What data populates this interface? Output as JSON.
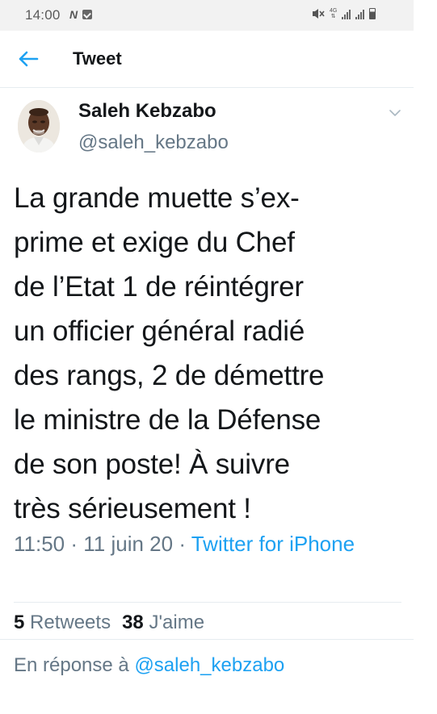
{
  "status_bar": {
    "time": "14:00",
    "network": "4G",
    "icons": [
      "notification-n-icon",
      "checkbox-notification-icon",
      "mute-icon",
      "signal-icon",
      "signal-icon",
      "battery-icon"
    ]
  },
  "header": {
    "title": "Tweet",
    "back_icon": "back-arrow-icon",
    "accent": "#1da1f2"
  },
  "tweet": {
    "author_name": "Saleh Kebzabo",
    "author_handle": "@saleh_kebzabo",
    "text": "La grande muette s’ex-\nprime et exige du Chef\nde l’Etat 1 de réintégrer\nun officier général radié\ndes rangs, 2 de démettre\nle ministre de la Défense\nde son poste! À suivre\ntrès sérieusement !",
    "time": "11:50",
    "separator": " · ",
    "date": "11 juin 20",
    "source": "Twitter for iPhone",
    "retweets_count": "5",
    "retweets_label": "Retweets",
    "likes_count": "38",
    "likes_label": "J'aime",
    "reply_prefix": "En réponse à ",
    "reply_handle": "@saleh_kebzabo"
  },
  "colors": {
    "link": "#1da1f2",
    "secondary_text": "#657786",
    "primary_text": "#14171a",
    "divider": "#e6ecf0"
  }
}
